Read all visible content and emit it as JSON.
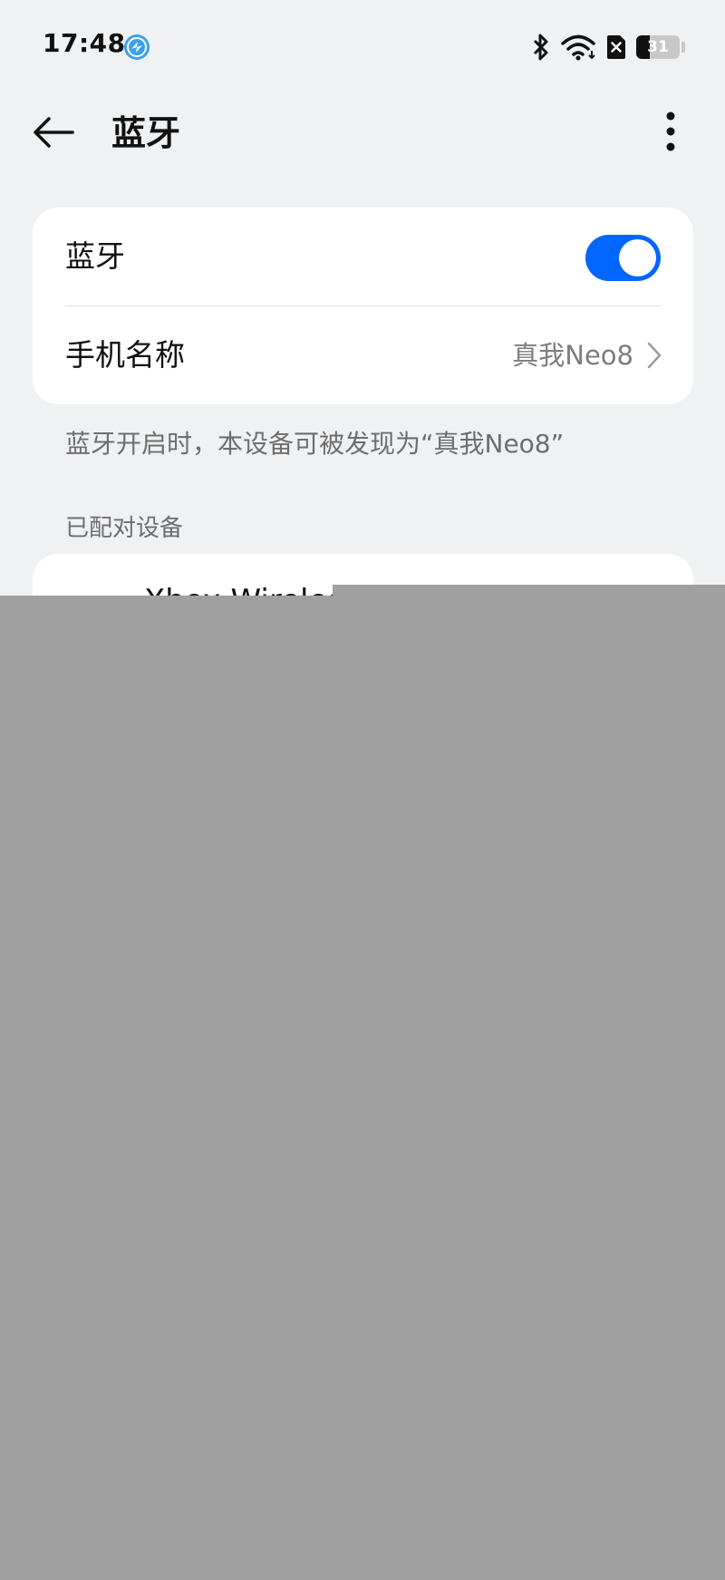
{
  "status_bar": {
    "time": "17:48",
    "app_badge_icon": "browser-badge-icon",
    "icons": [
      "bluetooth-icon",
      "wifi-icon",
      "no-sim-icon"
    ],
    "battery_level": "31",
    "battery_fraction": 0.31
  },
  "header": {
    "back_icon": "back-arrow-icon",
    "title": "蓝牙",
    "more_icon": "more-vertical-icon"
  },
  "bluetooth_card": {
    "toggle_label": "蓝牙",
    "toggle_on": true,
    "phone_name_label": "手机名称",
    "phone_name_value": "真我Neo8"
  },
  "hint": "蓝牙开启时，本设备可被发现为“真我Neo8”",
  "paired_section": {
    "header": "已配对设备",
    "devices": [
      {
        "name": "Xbox Wireless Controller",
        "icon": "gamepad-icon"
      }
    ]
  },
  "colors": {
    "accent": "#0066ff",
    "background": "#f0f1f3",
    "card": "#ffffff",
    "secondary_text": "#6e6e6e",
    "redaction": "#a0a0a0"
  }
}
